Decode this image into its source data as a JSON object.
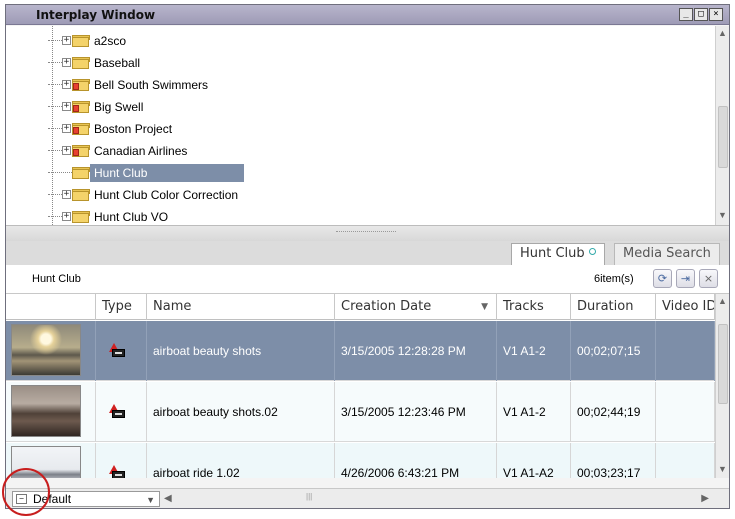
{
  "window": {
    "title": "Interplay Window"
  },
  "window_buttons": {
    "minimize": "_",
    "maximize": "□",
    "close": "×"
  },
  "tree": {
    "items": [
      {
        "label": "a2sco",
        "expander": "+",
        "marker": false,
        "selected": false
      },
      {
        "label": "Baseball",
        "expander": "+",
        "marker": false,
        "selected": false
      },
      {
        "label": "Bell South Swimmers",
        "expander": "+",
        "marker": true,
        "selected": false
      },
      {
        "label": "Big Swell",
        "expander": "+",
        "marker": true,
        "selected": false
      },
      {
        "label": "Boston Project",
        "expander": "+",
        "marker": true,
        "selected": false
      },
      {
        "label": "Canadian Airlines",
        "expander": "+",
        "marker": true,
        "selected": false
      },
      {
        "label": "Hunt Club",
        "expander": "",
        "marker": false,
        "selected": true
      },
      {
        "label": "Hunt Club Color Correction",
        "expander": "+",
        "marker": false,
        "selected": false
      },
      {
        "label": "Hunt Club VO",
        "expander": "+",
        "marker": false,
        "selected": false
      }
    ]
  },
  "tabs": [
    {
      "label": "Hunt Club",
      "active": true
    },
    {
      "label": "Media Search",
      "active": false
    }
  ],
  "infobar": {
    "bin_name": "Hunt Club",
    "item_count": "6item(s)"
  },
  "table": {
    "columns": [
      "Type",
      "Name",
      "Creation Date",
      "Tracks",
      "Duration",
      "Video ID"
    ],
    "rows": [
      {
        "name": "airboat beauty shots",
        "date": "3/15/2005 12:28:28 PM",
        "tracks": "V1 A1-2",
        "duration": "00;02;07;15",
        "selected": true
      },
      {
        "name": "airboat beauty shots.02",
        "date": "3/15/2005 12:23:46 PM",
        "tracks": "V1 A1-2",
        "duration": "00;02;44;19",
        "selected": false
      },
      {
        "name": "airboat ride 1.02",
        "date": "4/26/2006 6:43:21 PM",
        "tracks": "V1 A1-A2",
        "duration": "00;03;23;17",
        "selected": false
      }
    ]
  },
  "footer": {
    "view_preset": "Default"
  },
  "colors": {
    "selection": "#7d8ea8",
    "titlebar": "#a9a6c0",
    "annotation": "#c81e1e"
  }
}
